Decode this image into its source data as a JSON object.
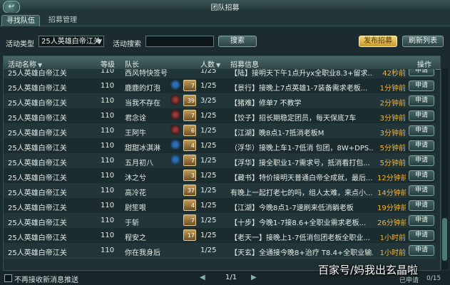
{
  "window": {
    "title": "团队招募"
  },
  "tabs": [
    {
      "label": "寻找队伍",
      "active": true
    },
    {
      "label": "招募管理",
      "active": false
    }
  ],
  "filter": {
    "activity_type_label": "活动类型",
    "activity_type_value": "25人英雄白帝江关",
    "search_label": "活动搜索",
    "search_value": "",
    "search_button": "搜索",
    "publish_button": "发布招募",
    "refresh_button": "刷新列表"
  },
  "table": {
    "headers": [
      "活动名称",
      "等级",
      "队长",
      "人数",
      "招募信息",
      "操作"
    ],
    "rows": [
      {
        "activity": "25人英雄白帝江关",
        "level": "110",
        "leader": "西风特快签号",
        "badge": "none",
        "badge_level": "",
        "count": "1/25",
        "info": "【陆】接明天下午1点升yx全职业8.3+留求...",
        "time": "42秒前",
        "action": "申请"
      },
      {
        "activity": "25人英雄白帝江关",
        "level": "110",
        "leader": "鹿鹿的灯泡",
        "badge": "fist",
        "badge_level": "7",
        "count": "1/25",
        "info": "【景行】接晚上7点英雄1-7装备需求老板...",
        "time": "1分钟前",
        "action": "申请"
      },
      {
        "activity": "25人英雄白帝江关",
        "level": "110",
        "leader": "当我不存在",
        "badge": "wing",
        "badge_level": "39",
        "count": "3/25",
        "info": "【猪难】修单7 不教学",
        "time": "2分钟前",
        "action": "申请"
      },
      {
        "activity": "25人英雄白帝江关",
        "level": "110",
        "leader": "君念诠",
        "badge": "wing",
        "badge_level": "7",
        "count": "1/25",
        "info": "【饺子】招长期稳定团员，每天保底7车",
        "time": "3分钟前",
        "action": "申请"
      },
      {
        "activity": "25人英雄白帝江关",
        "level": "110",
        "leader": "王阿牛",
        "badge": "wing",
        "badge_level": "6",
        "count": "1/25",
        "info": "【江湖】晚8点1-7抵消老板M",
        "time": "3分钟前",
        "action": "申请"
      },
      {
        "activity": "25人英雄白帝江关",
        "level": "110",
        "leader": "甜甜冰淇淋",
        "badge": "fist",
        "badge_level": "4",
        "count": "1/25",
        "info": "（浮华）接晚上车1-7低消 包团，8W+DPS...",
        "time": "5分钟前",
        "action": "申请"
      },
      {
        "activity": "25人英雄白帝江关",
        "level": "110",
        "leader": "五月初八",
        "badge": "fist",
        "badge_level": "7",
        "count": "1/25",
        "info": "【浮华】接全职业1-7需求号，抵消看打包...",
        "time": "5分钟前",
        "action": "申请"
      },
      {
        "activity": "25人英雄白帝江关",
        "level": "110",
        "leader": "沐之兮",
        "badge": "none",
        "badge_level": "3",
        "count": "1/25",
        "info": "【藏书】特价接明天普通白帝全成就，最后...",
        "time": "12分钟前",
        "action": "申请"
      },
      {
        "activity": "25人英雄白帝江关",
        "level": "110",
        "leader": "高冷花",
        "badge": "none",
        "badge_level": "37",
        "count": "1/25",
        "info": "有晚上一起打老七的吗，组人太难，来点小...",
        "time": "14分钟前",
        "action": "申请"
      },
      {
        "activity": "25人英雄白帝江关",
        "level": "110",
        "leader": "尉笙哏",
        "badge": "none",
        "badge_level": "4",
        "count": "1/25",
        "info": "【江湖】今晚8点1-7速刷来低消躺老板",
        "time": "19分钟前",
        "action": "申请"
      },
      {
        "activity": "25人英雄白帝江关",
        "level": "110",
        "leader": "于斩",
        "badge": "none",
        "badge_level": "7",
        "count": "1/25",
        "info": "【十步】今晚1-7接8.6+全职业需求老板...",
        "time": "26分钟前",
        "action": "申请"
      },
      {
        "activity": "25人英雄白帝江关",
        "level": "110",
        "leader": "程安之",
        "badge": "none",
        "badge_level": "17",
        "count": "1/25",
        "info": "【老天一】接晚上1-7低消包团老板全职业...",
        "time": "1小时前",
        "action": "申请"
      },
      {
        "activity": "25人英雄白帝江关",
        "level": "110",
        "leader": "你在我身后",
        "badge": "none",
        "badge_level": "",
        "count": "1/25",
        "info": "【天玄】全通接今晚8+治疗 T8.4+全职业输...",
        "time": "1小时前",
        "action": "申请"
      }
    ]
  },
  "footer": {
    "no_push_label": "不再接收新消息推送",
    "page": "1/1",
    "applied_label": "已申请",
    "applied_value": "0/15"
  },
  "watermark": "百家号/妈我出玄晶啦",
  "colors": {
    "accent_gold": "#f2b538",
    "panel_bg": "#1c2b2f"
  }
}
